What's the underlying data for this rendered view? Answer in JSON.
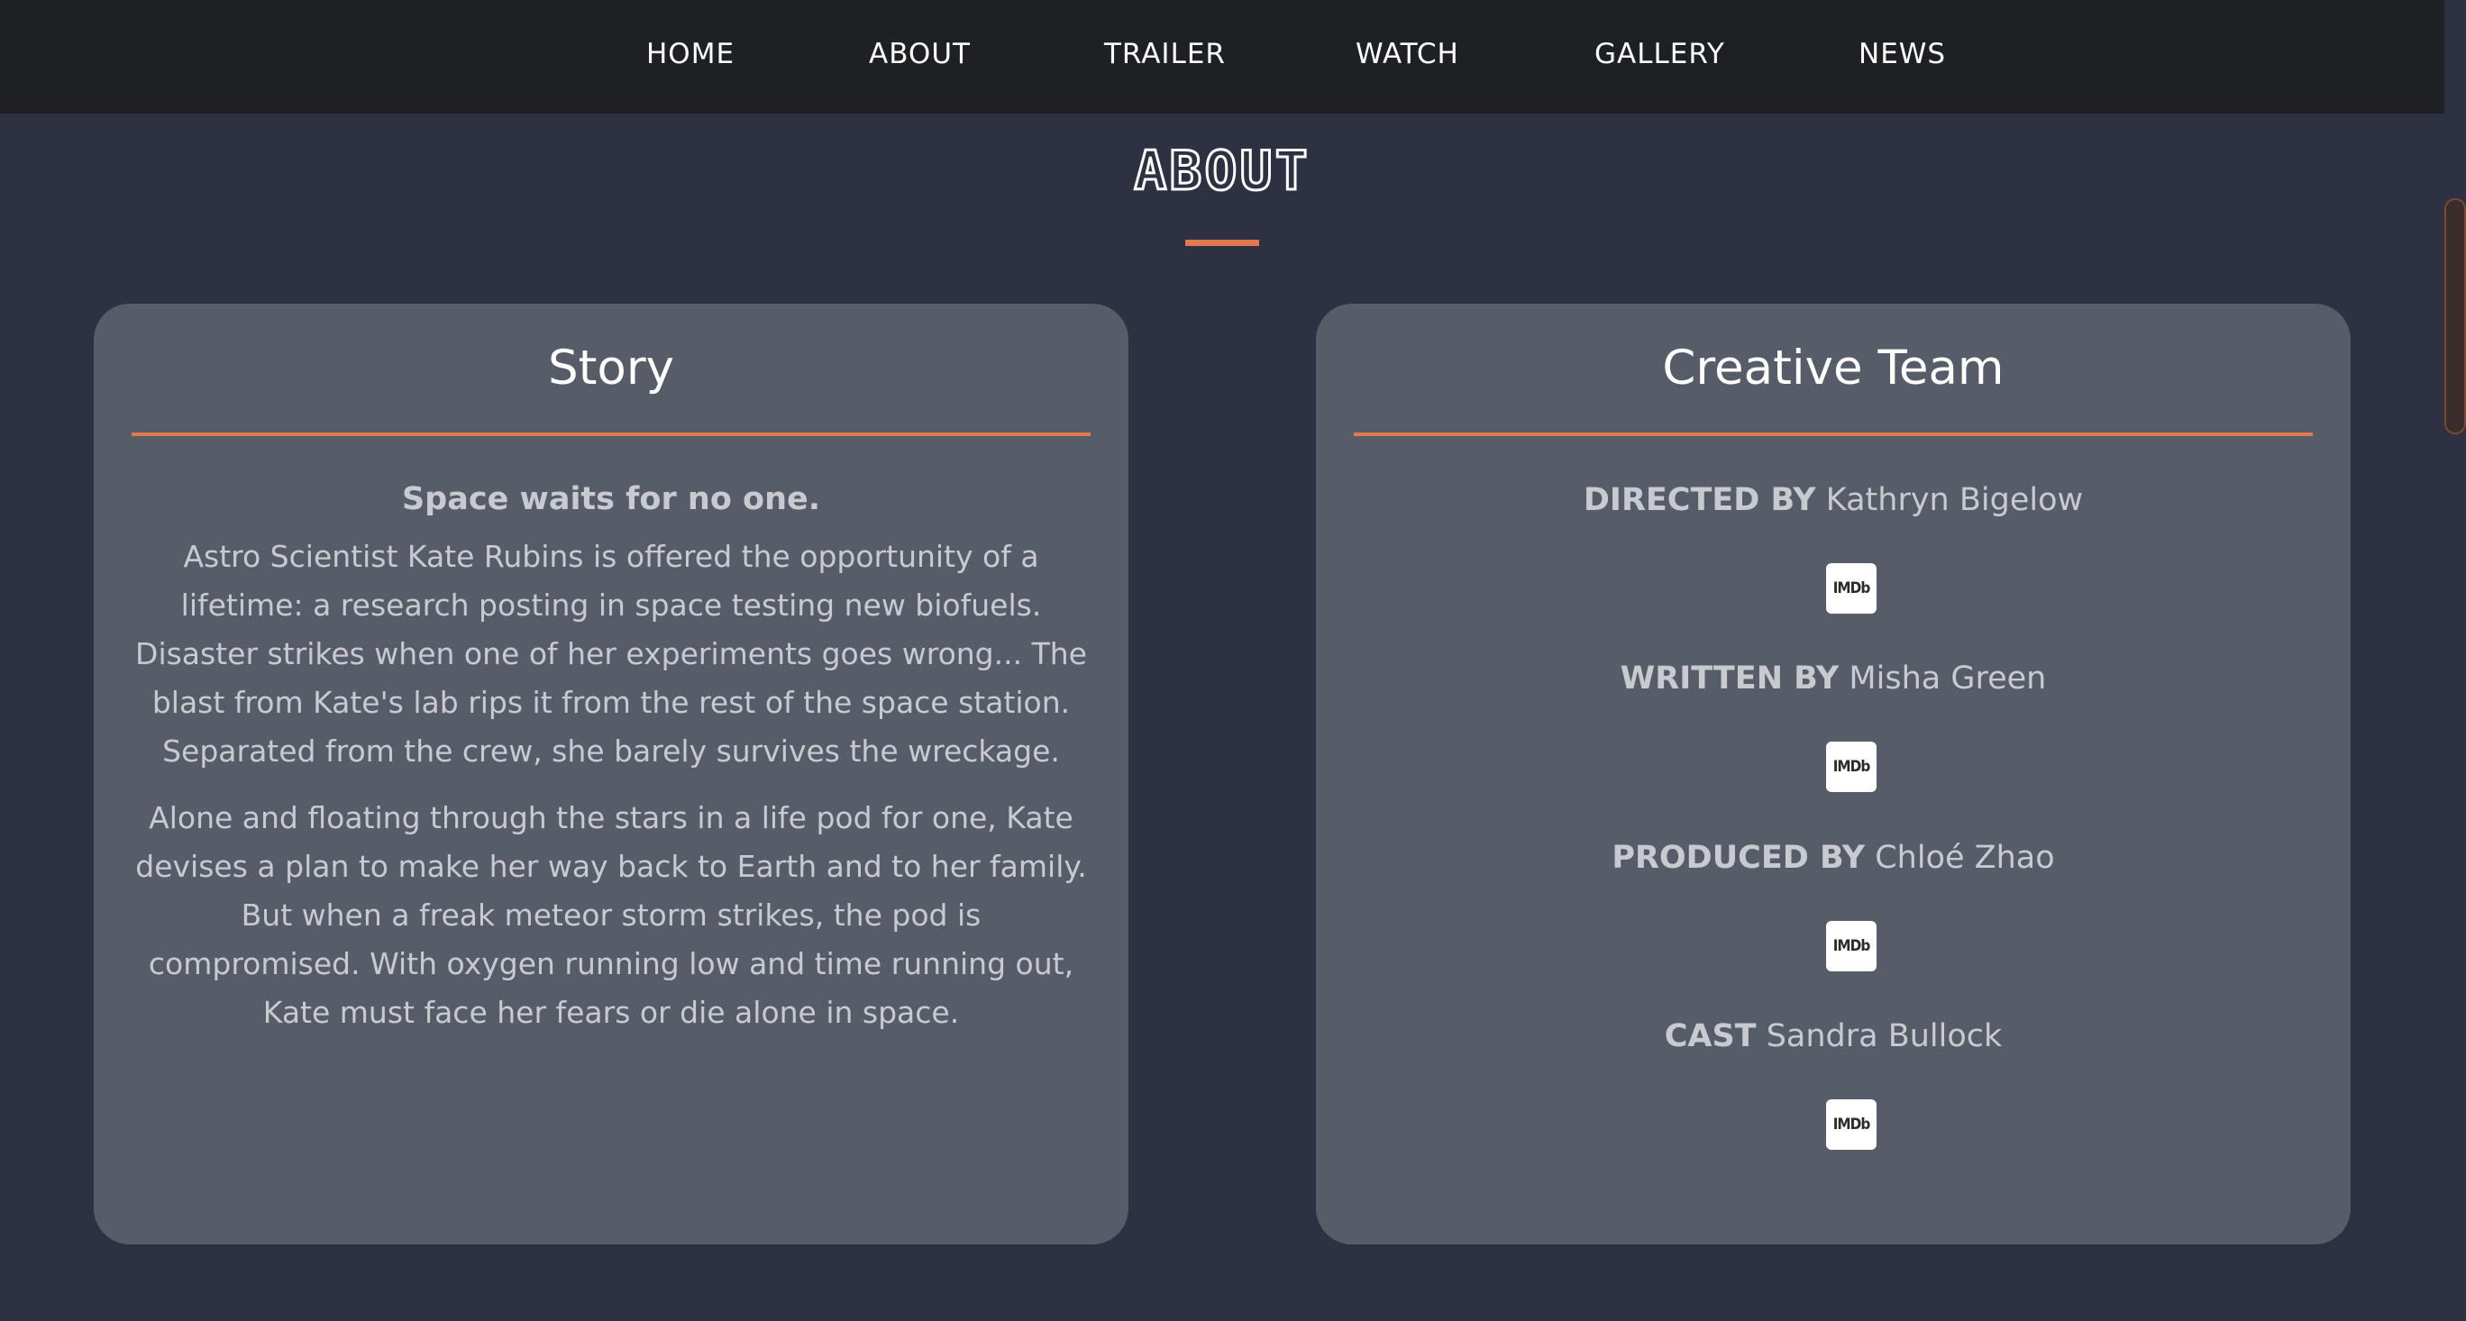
{
  "nav": {
    "items": [
      {
        "label": "HOME"
      },
      {
        "label": "ABOUT"
      },
      {
        "label": "TRAILER"
      },
      {
        "label": "WATCH"
      },
      {
        "label": "GALLERY"
      },
      {
        "label": "NEWS"
      }
    ]
  },
  "section": {
    "title": "ABOUT"
  },
  "story": {
    "heading": "Story",
    "tagline": "Space waits for no one.",
    "paragraphs": [
      "Astro Scientist Kate Rubins is offered the opportunity of a lifetime: a research posting in space testing new biofuels. Disaster strikes when one of her experiments goes wrong... The blast from Kate's lab rips it from the rest of the space station. Separated from the crew, she barely survives the wreckage.",
      "Alone and floating through the stars in a life pod for one, Kate devises a plan to make her way back to Earth and to her family. But when a freak meteor storm strikes, the pod is compromised. With oxygen running low and time running out, Kate must face her fears or die alone in space."
    ]
  },
  "team": {
    "heading": "Creative Team",
    "credits": [
      {
        "role": "DIRECTED BY",
        "name": "Kathryn Bigelow",
        "badge": "IMDb"
      },
      {
        "role": "WRITTEN BY",
        "name": "Misha Green",
        "badge": "IMDb"
      },
      {
        "role": "PRODUCED BY",
        "name": "Chloé Zhao",
        "badge": "IMDb"
      },
      {
        "role": "CAST",
        "name": "Sandra Bullock",
        "badge": "IMDb"
      }
    ]
  },
  "colors": {
    "accent": "#e0794f",
    "background": "#2d3142",
    "card": "#575c69",
    "nav": "#1f2024"
  }
}
